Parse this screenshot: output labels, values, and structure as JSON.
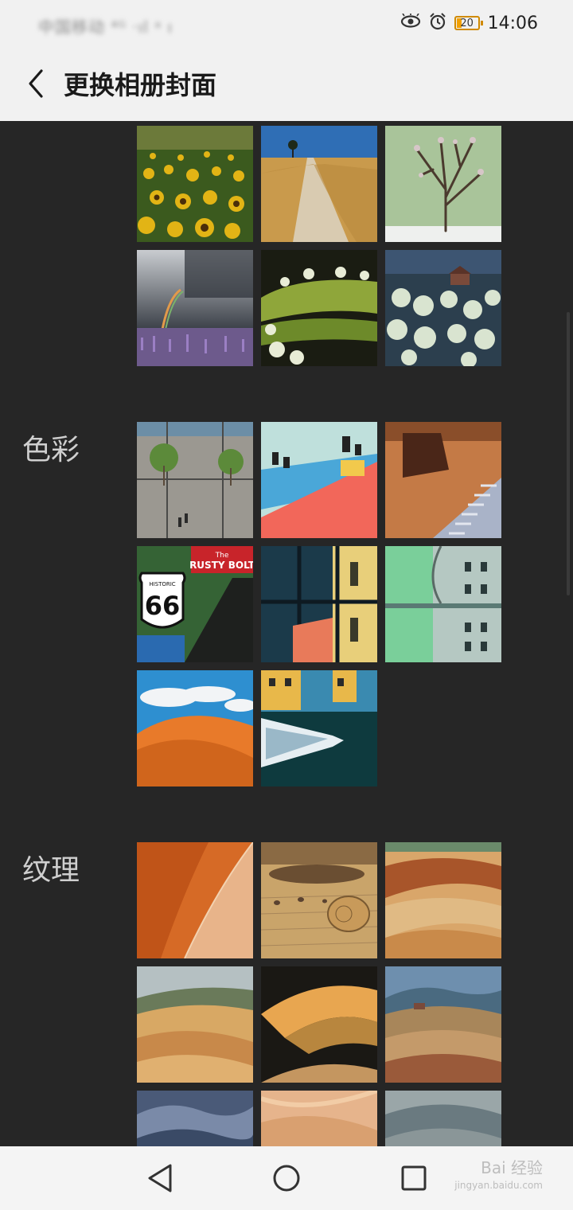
{
  "status_bar": {
    "carrier": "中国移动 ⁴ᴳ ·ıl ᵃ ı",
    "battery": "20",
    "time": "14:06",
    "icons": [
      "eye-icon",
      "alarm-icon",
      "battery-icon"
    ]
  },
  "header": {
    "back_icon": "chevron-left-icon",
    "title": "更换相册封面"
  },
  "sections": [
    {
      "label": "",
      "items": [
        "sunflower-field",
        "country-road",
        "bare-tree",
        "rainbow-lupines",
        "green-hills",
        "hillside-house"
      ]
    },
    {
      "label": "色彩",
      "items": [
        "plaza-trees",
        "colored-rooftops",
        "orange-stairs",
        "route-66-sign",
        "window-reflection",
        "mint-building",
        "orange-dune",
        "boat-canal"
      ]
    },
    {
      "label": "纹理",
      "items": [
        "dune-ridge",
        "hay-bale",
        "rolling-fields",
        "tuscany-fields",
        "dark-dune",
        "farmhouse-hills",
        "blue-waves",
        "peach-sand",
        "soft-hills"
      ]
    }
  ],
  "nav_bar": {
    "back_icon": "nav-back-icon",
    "home_icon": "nav-home-icon",
    "recent_icon": "nav-recent-icon"
  },
  "watermark": {
    "brand": "Bai 经验",
    "url": "jingyan.baidu.com"
  }
}
